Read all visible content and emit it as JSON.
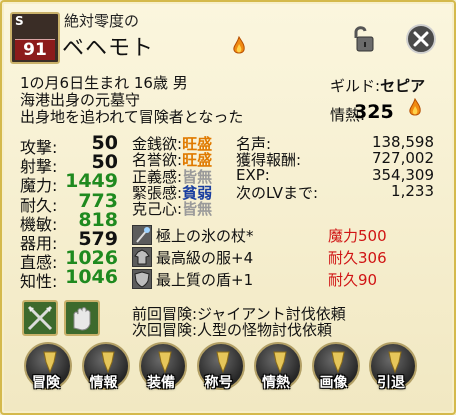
{
  "header": {
    "rank_letter": "S",
    "level": "91",
    "epithet": "絶対零度の",
    "name": "ベヘモト"
  },
  "profile": {
    "birth_line": "1の月6日生まれ 16歳 男",
    "origin_line": "海港出身の元墓守",
    "reason_line": "出身地を追われて冒険者となった",
    "guild_label": "ギルド:",
    "guild_value": "セピア",
    "passion_label": "情熱:",
    "passion_value": "325"
  },
  "stats": [
    {
      "label": "攻撃:",
      "value": "50",
      "color": "#111111"
    },
    {
      "label": "射撃:",
      "value": "50",
      "color": "#111111"
    },
    {
      "label": "魔力:",
      "value": "1449",
      "color": "#1f8a1f"
    },
    {
      "label": "耐久:",
      "value": "773",
      "color": "#1f8a1f"
    },
    {
      "label": "機敏:",
      "value": "818",
      "color": "#1f8a1f"
    },
    {
      "label": "器用:",
      "value": "579",
      "color": "#111111"
    },
    {
      "label": "直感:",
      "value": "1026",
      "color": "#1f8a1f"
    },
    {
      "label": "知性:",
      "value": "1046",
      "color": "#1f8a1f"
    }
  ],
  "desires": [
    {
      "label": "金銭欲:",
      "value": "旺盛",
      "style": "hi"
    },
    {
      "label": "名誉欲:",
      "value": "旺盛",
      "style": "hi"
    },
    {
      "label": "正義感:",
      "value": "皆無",
      "style": "gray"
    },
    {
      "label": "緊張感:",
      "value": "貧弱",
      "style": "blue"
    },
    {
      "label": "克己心:",
      "value": "皆無",
      "style": "gray"
    }
  ],
  "records": [
    {
      "label": "名声:",
      "value": "138,598"
    },
    {
      "label": "獲得報酬:",
      "value": "727,002"
    },
    {
      "label": "EXP:",
      "value": "354,309"
    },
    {
      "label": "次のLVまで:",
      "value": "1,233"
    }
  ],
  "equipment": [
    {
      "name": "極上の氷の杖*",
      "stat": "魔力500",
      "icon": "staff-icon"
    },
    {
      "name": "最高級の服+4",
      "stat": "耐久306",
      "icon": "clothing-icon"
    },
    {
      "name": "最上質の盾+1",
      "stat": "耐久90",
      "icon": "shield-icon"
    }
  ],
  "adventures": {
    "previous": "前回冒険:ジャイアント討伐依頼",
    "next": "次回冒険:人型の怪物討伐依頼"
  },
  "menu": [
    {
      "label": "冒険",
      "icon": "adventure-icon"
    },
    {
      "label": "情報",
      "icon": "info-icon"
    },
    {
      "label": "装備",
      "icon": "equipment-icon"
    },
    {
      "label": "称号",
      "icon": "title-icon"
    },
    {
      "label": "情熱",
      "icon": "passion-icon"
    },
    {
      "label": "画像",
      "icon": "image-icon"
    },
    {
      "label": "引退",
      "icon": "retire-icon"
    }
  ],
  "colors": {
    "frame_gold": "#d4b94c",
    "stat_green": "#1f8a1f",
    "desire_orange": "#e07a00",
    "equip_red": "#d01414",
    "level_red": "#8c1b1b"
  }
}
